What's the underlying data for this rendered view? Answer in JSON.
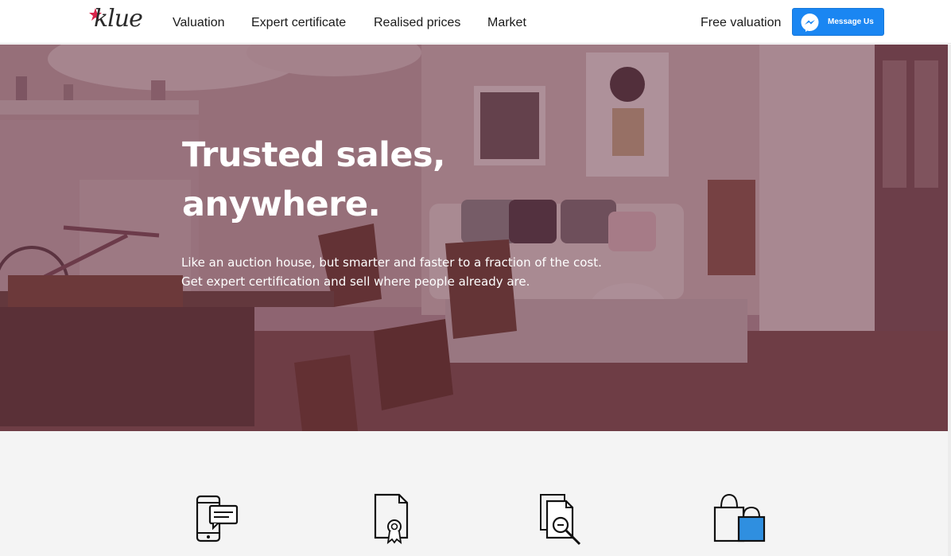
{
  "header": {
    "logo_text": "klue",
    "nav": [
      "Valuation",
      "Expert certificate",
      "Realised prices",
      "Market"
    ],
    "free_valuation": "Free valuation",
    "message_button": "Message Us"
  },
  "hero": {
    "title_line1": "Trusted sales,",
    "title_line2": "anywhere.",
    "subtitle_line1": "Like an auction house, but smarter and faster to a fraction of the cost.",
    "subtitle_line2": "Get expert certification and sell where people already are."
  },
  "features": {
    "icons": [
      "phone-chat-icon",
      "certificate-icon",
      "document-search-icon",
      "shopping-bag-icon"
    ]
  },
  "colors": {
    "accent": "#1a86f2",
    "logo_star": "#d8244a",
    "hero_overlay": "#5c2438",
    "features_bg": "#f4f4f4",
    "bag_fill": "#2f8fe0"
  }
}
